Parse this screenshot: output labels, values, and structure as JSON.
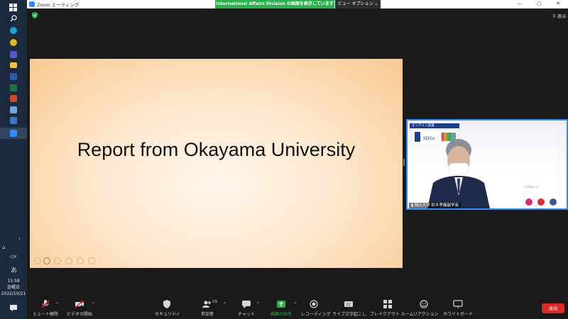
{
  "window": {
    "title": "Zoom ミーティング",
    "share_banner": "International  Affairs  Division の画面を表示しています",
    "view_options": "ビュー オプション",
    "show_button": "表示"
  },
  "slide": {
    "title": "Report from Okayama University"
  },
  "video": {
    "speaker_label": "岡山大学 鈴木孝義副学長",
    "banner_text": "オンライン会議",
    "sdg_text": "SDGs"
  },
  "taskbar": {
    "time": "15:58",
    "weekday": "金曜日",
    "date": "2022/10/21",
    "ime": "あ"
  },
  "toolbar": {
    "mute": "ミュート解除",
    "video": "ビデオの開始",
    "security": "セキュリティ",
    "participants": "参加者",
    "participant_count": "29",
    "chat": "チャット",
    "share": "画面の共有",
    "record": "レコーディング",
    "captions": "ライブ文字起こし",
    "breakout": "ブレイクアウト ルーム",
    "reactions": "リアクション",
    "whiteboard": "ホワイトボード",
    "leave": "退出"
  },
  "colors": {
    "share_green": "#27b34a",
    "zoom_blue": "#2d8cff",
    "leave_red": "#e02828"
  }
}
